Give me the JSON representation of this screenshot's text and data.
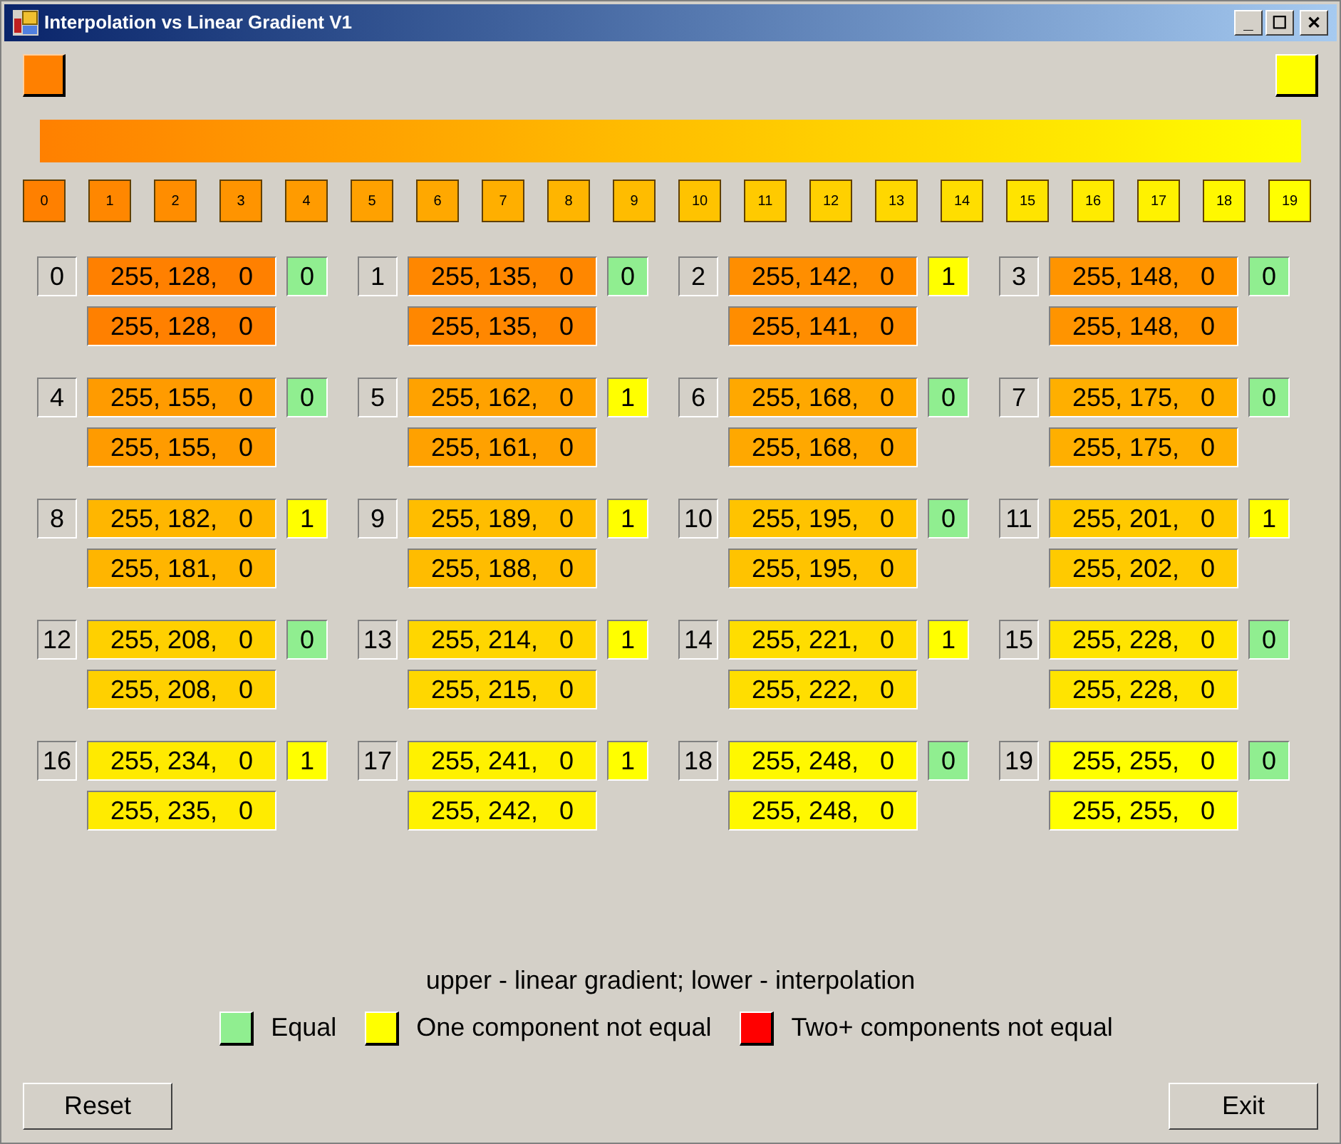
{
  "window": {
    "title": "Interpolation vs Linear Gradient V1",
    "controls": [
      "_",
      "☐",
      "✕"
    ]
  },
  "start_color": {
    "color": "#ff8000"
  },
  "end_color": {
    "color": "#ffff00"
  },
  "swatches": [
    {
      "label": "0",
      "color": "#ff8000"
    },
    {
      "label": "1",
      "color": "#ff8700"
    },
    {
      "label": "2",
      "color": "#ff8d00"
    },
    {
      "label": "3",
      "color": "#ff9400"
    },
    {
      "label": "4",
      "color": "#ff9b00"
    },
    {
      "label": "5",
      "color": "#ffa100"
    },
    {
      "label": "6",
      "color": "#ffa800"
    },
    {
      "label": "7",
      "color": "#ffaf00"
    },
    {
      "label": "8",
      "color": "#ffb500"
    },
    {
      "label": "9",
      "color": "#ffbc00"
    },
    {
      "label": "10",
      "color": "#ffc300"
    },
    {
      "label": "11",
      "color": "#ffca00"
    },
    {
      "label": "12",
      "color": "#ffd000"
    },
    {
      "label": "13",
      "color": "#ffd700"
    },
    {
      "label": "14",
      "color": "#ffde00"
    },
    {
      "label": "15",
      "color": "#ffe400"
    },
    {
      "label": "16",
      "color": "#ffeb00"
    },
    {
      "label": "17",
      "color": "#fff200"
    },
    {
      "label": "18",
      "color": "#fff800"
    },
    {
      "label": "19",
      "color": "#ffff00"
    }
  ],
  "cells": [
    {
      "index": "0",
      "upper": {
        "text": "255, 128,   0",
        "color": "#ff8000"
      },
      "lower": {
        "text": "255, 128,   0",
        "color": "#ff8000"
      },
      "diff": {
        "text": "0",
        "color": "#90ee90"
      }
    },
    {
      "index": "1",
      "upper": {
        "text": "255, 135,   0",
        "color": "#ff8700"
      },
      "lower": {
        "text": "255, 135,   0",
        "color": "#ff8700"
      },
      "diff": {
        "text": "0",
        "color": "#90ee90"
      }
    },
    {
      "index": "2",
      "upper": {
        "text": "255, 142,   0",
        "color": "#ff8e00"
      },
      "lower": {
        "text": "255, 141,   0",
        "color": "#ff8d00"
      },
      "diff": {
        "text": "1",
        "color": "#ffff00"
      }
    },
    {
      "index": "3",
      "upper": {
        "text": "255, 148,   0",
        "color": "#ff9400"
      },
      "lower": {
        "text": "255, 148,   0",
        "color": "#ff9400"
      },
      "diff": {
        "text": "0",
        "color": "#90ee90"
      }
    },
    {
      "index": "4",
      "upper": {
        "text": "255, 155,   0",
        "color": "#ff9b00"
      },
      "lower": {
        "text": "255, 155,   0",
        "color": "#ff9b00"
      },
      "diff": {
        "text": "0",
        "color": "#90ee90"
      }
    },
    {
      "index": "5",
      "upper": {
        "text": "255, 162,   0",
        "color": "#ffa200"
      },
      "lower": {
        "text": "255, 161,   0",
        "color": "#ffa100"
      },
      "diff": {
        "text": "1",
        "color": "#ffff00"
      }
    },
    {
      "index": "6",
      "upper": {
        "text": "255, 168,   0",
        "color": "#ffa800"
      },
      "lower": {
        "text": "255, 168,   0",
        "color": "#ffa800"
      },
      "diff": {
        "text": "0",
        "color": "#90ee90"
      }
    },
    {
      "index": "7",
      "upper": {
        "text": "255, 175,   0",
        "color": "#ffaf00"
      },
      "lower": {
        "text": "255, 175,   0",
        "color": "#ffaf00"
      },
      "diff": {
        "text": "0",
        "color": "#90ee90"
      }
    },
    {
      "index": "8",
      "upper": {
        "text": "255, 182,   0",
        "color": "#ffb600"
      },
      "lower": {
        "text": "255, 181,   0",
        "color": "#ffb500"
      },
      "diff": {
        "text": "1",
        "color": "#ffff00"
      }
    },
    {
      "index": "9",
      "upper": {
        "text": "255, 189,   0",
        "color": "#ffbd00"
      },
      "lower": {
        "text": "255, 188,   0",
        "color": "#ffbc00"
      },
      "diff": {
        "text": "1",
        "color": "#ffff00"
      }
    },
    {
      "index": "10",
      "upper": {
        "text": "255, 195,   0",
        "color": "#ffc300"
      },
      "lower": {
        "text": "255, 195,   0",
        "color": "#ffc300"
      },
      "diff": {
        "text": "0",
        "color": "#90ee90"
      }
    },
    {
      "index": "11",
      "upper": {
        "text": "255, 201,   0",
        "color": "#ffc900"
      },
      "lower": {
        "text": "255, 202,   0",
        "color": "#ffca00"
      },
      "diff": {
        "text": "1",
        "color": "#ffff00"
      }
    },
    {
      "index": "12",
      "upper": {
        "text": "255, 208,   0",
        "color": "#ffd000"
      },
      "lower": {
        "text": "255, 208,   0",
        "color": "#ffd000"
      },
      "diff": {
        "text": "0",
        "color": "#90ee90"
      }
    },
    {
      "index": "13",
      "upper": {
        "text": "255, 214,   0",
        "color": "#ffd600"
      },
      "lower": {
        "text": "255, 215,   0",
        "color": "#ffd700"
      },
      "diff": {
        "text": "1",
        "color": "#ffff00"
      }
    },
    {
      "index": "14",
      "upper": {
        "text": "255, 221,   0",
        "color": "#ffdd00"
      },
      "lower": {
        "text": "255, 222,   0",
        "color": "#ffde00"
      },
      "diff": {
        "text": "1",
        "color": "#ffff00"
      }
    },
    {
      "index": "15",
      "upper": {
        "text": "255, 228,   0",
        "color": "#ffe400"
      },
      "lower": {
        "text": "255, 228,   0",
        "color": "#ffe400"
      },
      "diff": {
        "text": "0",
        "color": "#90ee90"
      }
    },
    {
      "index": "16",
      "upper": {
        "text": "255, 234,   0",
        "color": "#ffea00"
      },
      "lower": {
        "text": "255, 235,   0",
        "color": "#ffeb00"
      },
      "diff": {
        "text": "1",
        "color": "#ffff00"
      }
    },
    {
      "index": "17",
      "upper": {
        "text": "255, 241,   0",
        "color": "#fff100"
      },
      "lower": {
        "text": "255, 242,   0",
        "color": "#fff200"
      },
      "diff": {
        "text": "1",
        "color": "#ffff00"
      }
    },
    {
      "index": "18",
      "upper": {
        "text": "255, 248,   0",
        "color": "#fff800"
      },
      "lower": {
        "text": "255, 248,   0",
        "color": "#fff800"
      },
      "diff": {
        "text": "0",
        "color": "#90ee90"
      }
    },
    {
      "index": "19",
      "upper": {
        "text": "255, 255,   0",
        "color": "#ffff00"
      },
      "lower": {
        "text": "255, 255,   0",
        "color": "#ffff00"
      },
      "diff": {
        "text": "0",
        "color": "#90ee90"
      }
    }
  ],
  "caption": "upper - linear gradient; lower - interpolation",
  "legend": [
    {
      "label": "Equal",
      "color": "#90ee90"
    },
    {
      "label": "One component not equal",
      "color": "#ffff00"
    },
    {
      "label": "Two+ components not equal",
      "color": "#ff0000"
    }
  ],
  "buttons": [
    "Reset",
    "Exit"
  ]
}
